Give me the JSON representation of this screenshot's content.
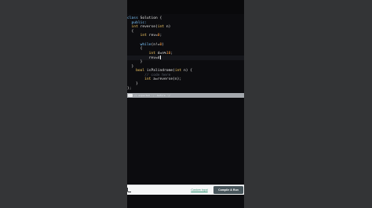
{
  "code_lines": [
    {
      "tokens": [
        {
          "t": "class ",
          "c": "kw"
        },
        {
          "t": "Solution {",
          "c": ""
        }
      ]
    },
    {
      "tokens": [
        {
          "t": "  public:",
          "c": "kw"
        }
      ]
    },
    {
      "tokens": [
        {
          "t": "  int ",
          "c": "ty"
        },
        {
          "t": "reverse(",
          "c": ""
        },
        {
          "t": "int ",
          "c": "ty"
        },
        {
          "t": "n)",
          "c": ""
        }
      ]
    },
    {
      "tokens": [
        {
          "t": "  {",
          "c": ""
        }
      ]
    },
    {
      "tokens": [
        {
          "t": "      int ",
          "c": "ty"
        },
        {
          "t": "rev=",
          "c": ""
        },
        {
          "t": "0",
          "c": "num"
        },
        {
          "t": ";",
          "c": ""
        }
      ]
    },
    {
      "tokens": [
        {
          "t": "",
          "c": ""
        }
      ]
    },
    {
      "tokens": [
        {
          "t": "      while",
          "c": "kw"
        },
        {
          "t": "(n!=",
          "c": ""
        },
        {
          "t": "0",
          "c": "num"
        },
        {
          "t": ")",
          "c": ""
        }
      ]
    },
    {
      "tokens": [
        {
          "t": "      {",
          "c": ""
        }
      ]
    },
    {
      "tokens": [
        {
          "t": "          int ",
          "c": "ty"
        },
        {
          "t": "d=n%",
          "c": ""
        },
        {
          "t": "10",
          "c": "num"
        },
        {
          "t": ";",
          "c": ""
        }
      ]
    },
    {
      "tokens": [
        {
          "t": "          rev=d",
          "c": ""
        }
      ]
    },
    {
      "tokens": [
        {
          "t": "      }",
          "c": ""
        }
      ]
    },
    {
      "tokens": [
        {
          "t": "  }",
          "c": ""
        }
      ]
    },
    {
      "tokens": [
        {
          "t": "    bool ",
          "c": "ty"
        },
        {
          "t": "isPalindrome(",
          "c": ""
        },
        {
          "t": "int ",
          "c": "ty"
        },
        {
          "t": "n) {",
          "c": ""
        }
      ]
    },
    {
      "tokens": [
        {
          "t": "        // code here",
          "c": "cm"
        }
      ]
    },
    {
      "tokens": [
        {
          "t": "        int ",
          "c": "ty"
        },
        {
          "t": "a=reverse(n);",
          "c": ""
        }
      ]
    },
    {
      "tokens": [
        {
          "t": "    }",
          "c": ""
        }
      ]
    },
    {
      "tokens": [
        {
          "t": "};",
          "c": ""
        }
      ]
    }
  ],
  "cursor_line_index": 9,
  "diagnostic": {
    "text": "// expected ';' before '}'"
  },
  "footer": {
    "custom_input_label": "Custom Input",
    "run_label": "Compile & Run"
  }
}
